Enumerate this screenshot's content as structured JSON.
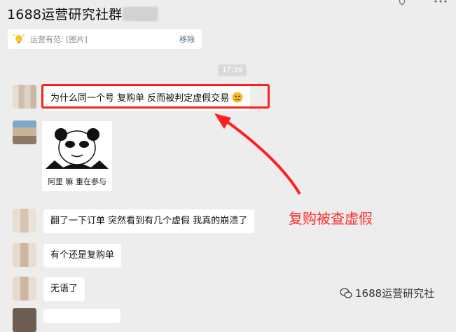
{
  "header": {
    "title": "1688运营研究社群"
  },
  "pinned": {
    "text": "运营有范: [图片]",
    "remove_label": "移除"
  },
  "chat": {
    "timestamp": "17:39",
    "messages": [
      {
        "text": "为什么同一个号  复购单 反而被判定虚假交易"
      },
      {
        "sticker_caption": "阿里  嘛  重在参与"
      },
      {
        "text": "翻了一下订单 突然看到有几个虚假  我真的崩溃了"
      },
      {
        "text": "有个还是复购单"
      },
      {
        "text": "无语了"
      }
    ]
  },
  "annotation": {
    "text": "复购被查虚假",
    "color": "#ff2a2a"
  },
  "watermark": {
    "text": "1688运营研究社"
  },
  "colors": {
    "background": "#ededed",
    "bubble": "#ffffff",
    "highlight": "#ff1f1f",
    "link": "#576b95"
  }
}
